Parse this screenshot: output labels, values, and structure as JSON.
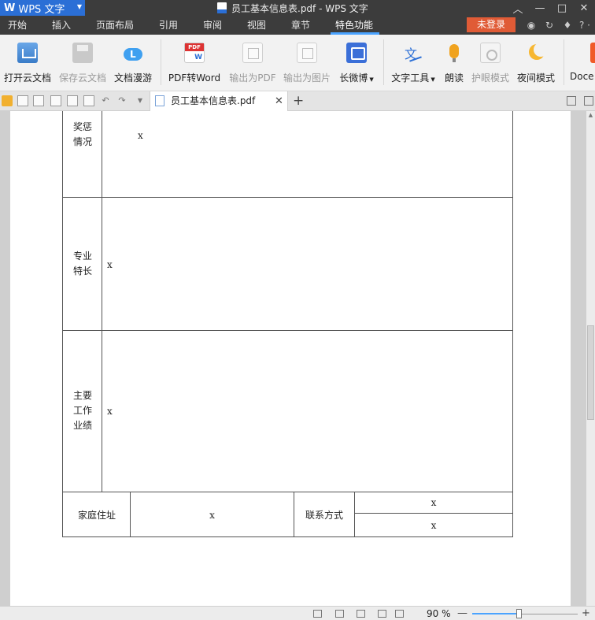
{
  "window": {
    "app_logo": "W",
    "app_name": "WPS 文字",
    "title": "员工基本信息表.pdf - WPS 文字",
    "help": "? ·"
  },
  "menu": {
    "tabs": [
      "开始",
      "插入",
      "页面布局",
      "引用",
      "审阅",
      "视图",
      "章节",
      "特色功能"
    ],
    "active_tab": "特色功能",
    "login_label": "未登录"
  },
  "ribbon": {
    "open_cloud": "打开云文档",
    "save_cloud": "保存云文档",
    "roam": "文档漫游",
    "pdf_to_word": "PDF转Word",
    "export_pdf": "输出为PDF",
    "export_image": "输出为图片",
    "long_weibo": "长微博",
    "text_tools": "文字工具",
    "read_aloud": "朗读",
    "eye_mode": "护眼模式",
    "night_mode": "夜间模式",
    "docer": "Doce"
  },
  "doc_tab": {
    "label": "员工基本信息表.pdf"
  },
  "table": {
    "awards_label_1": "奖惩",
    "awards_label_2": "情况",
    "awards_value": "x",
    "specialty_label_1": "专业",
    "specialty_label_2": "特长",
    "specialty_value": "x",
    "achievements_label_1": "主要",
    "achievements_label_2": "工作",
    "achievements_label_3": "业绩",
    "achievements_value": "x",
    "address_label": "家庭住址",
    "address_value": "x",
    "contact_label": "联系方式",
    "contact_value_1": "x",
    "contact_value_2": "x"
  },
  "status": {
    "zoom": "90 %",
    "zoom_fraction": 0.44
  }
}
